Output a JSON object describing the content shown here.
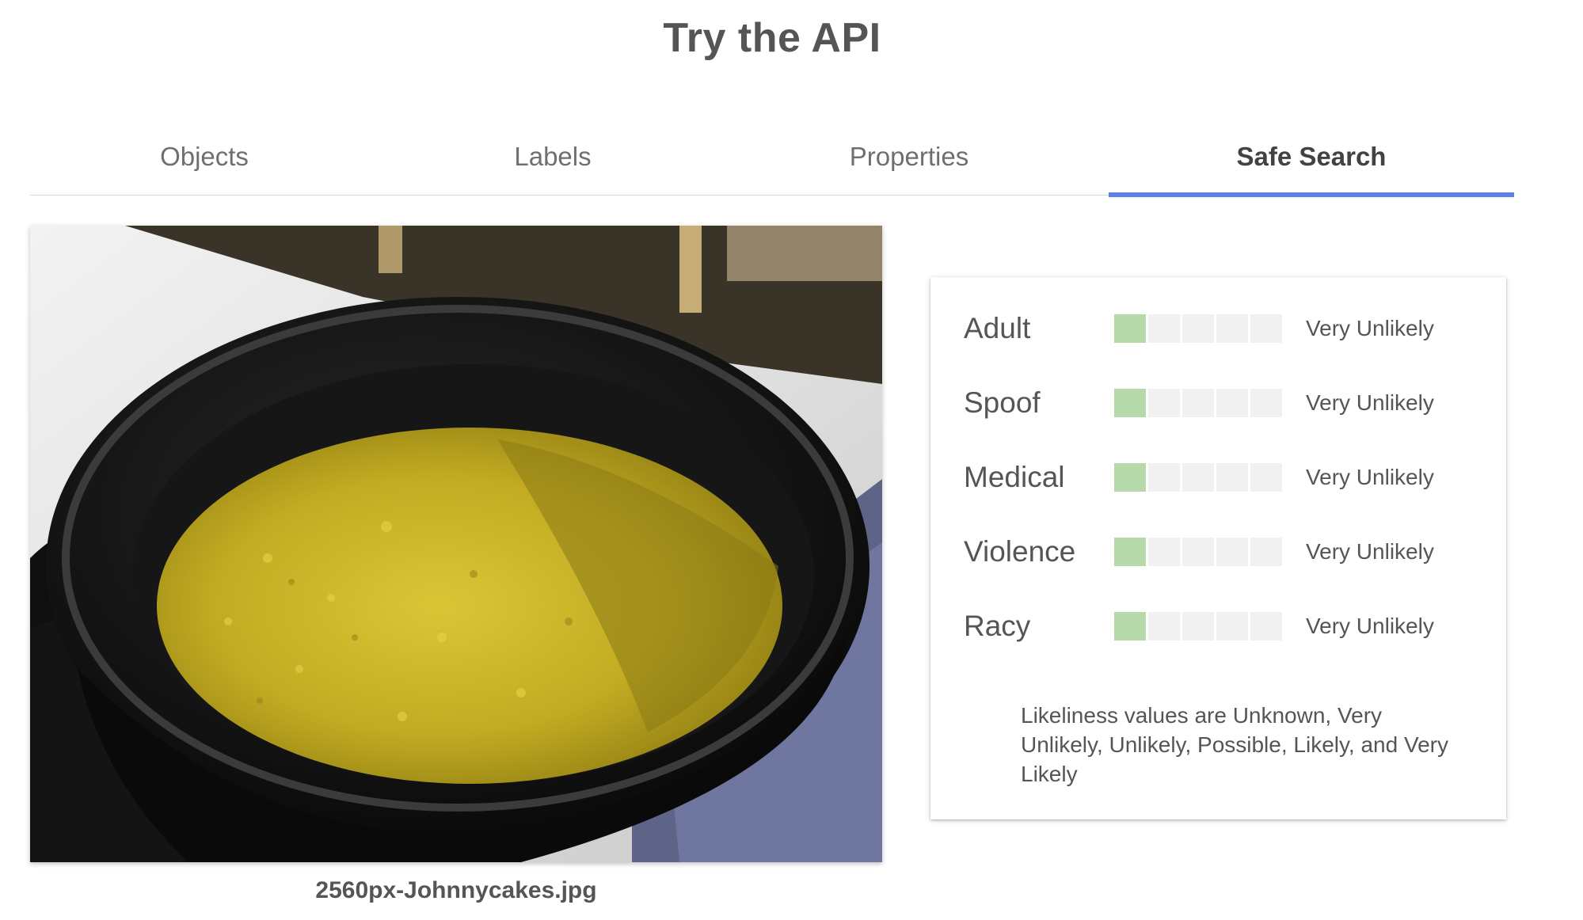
{
  "page": {
    "title": "Try the API"
  },
  "tabs": [
    {
      "label": "Objects",
      "active": false
    },
    {
      "label": "Labels",
      "active": false
    },
    {
      "label": "Properties",
      "active": false
    },
    {
      "label": "Safe Search",
      "active": true
    }
  ],
  "image": {
    "caption": "2560px-Johnnycakes.jpg",
    "depiction": "cast-iron-skillet-with-johnnycake"
  },
  "safe_search": {
    "scale_steps": 5,
    "results": [
      {
        "label": "Adult",
        "value": "Very Unlikely",
        "level": 1
      },
      {
        "label": "Spoof",
        "value": "Very Unlikely",
        "level": 1
      },
      {
        "label": "Medical",
        "value": "Very Unlikely",
        "level": 1
      },
      {
        "label": "Violence",
        "value": "Very Unlikely",
        "level": 1
      },
      {
        "label": "Racy",
        "value": "Very Unlikely",
        "level": 1
      }
    ],
    "footnote": "Likeliness values are Unknown, Very Unlikely, Unlikely, Possible, Likely, and Very Likely"
  },
  "colors": {
    "accent": "#5b82e8",
    "bar_filled": "#b5d9a8",
    "bar_empty": "#f1f1f1"
  }
}
